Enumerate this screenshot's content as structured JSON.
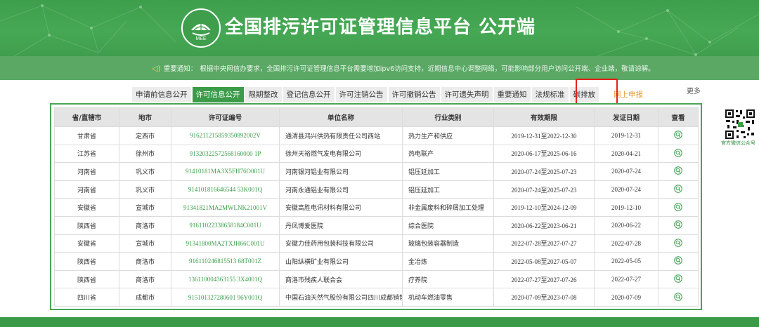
{
  "header": {
    "title": "全国排污许可证管理信息平台  公开端",
    "logo_text": "MEE"
  },
  "notice": {
    "label": "重要通知：",
    "text": "根据中央网信办要求，全国排污许可证管理信息平台需要增加ipv6访问支持，近期信息中心调整网络，可能影响部分用户访问公开端、企业端，敬请谅解。"
  },
  "tabs": [
    {
      "label": "申请前信息公开"
    },
    {
      "label": "许可信息公开"
    },
    {
      "label": "限期整改"
    },
    {
      "label": "登记信息公开"
    },
    {
      "label": "许可注销公告"
    },
    {
      "label": "许可撤销公告"
    },
    {
      "label": "许可遗失声明"
    },
    {
      "label": "重要通知"
    },
    {
      "label": "法规标准"
    },
    {
      "label": "碳排放"
    },
    {
      "label": "网上申报"
    }
  ],
  "more_label": "更多",
  "table": {
    "headers": [
      "省/直辖市",
      "地市",
      "许可证编号",
      "单位名称",
      "行业类别",
      "有效期限",
      "发证日期",
      "查看"
    ],
    "rows": [
      {
        "province": "甘肃省",
        "city": "定西市",
        "permit": "916211215859350892002V",
        "company": "通渭县鸿兴供热有限责任公司西站",
        "industry": "热力生产和供应",
        "validity": "2019-12-31至2022-12-30",
        "issue_date": "2019-12-31"
      },
      {
        "province": "江苏省",
        "city": "徐州市",
        "permit": "91320322572568160000 1P",
        "company": "徐州天裕燃气发电有限公司",
        "industry": "热电联产",
        "validity": "2020-06-17至2025-06-16",
        "issue_date": "2020-04-21"
      },
      {
        "province": "河南省",
        "city": "巩义市",
        "permit": "91410181MA3X5FH76O001U",
        "company": "河南银河铝业有限公司",
        "industry": "铝压延加工",
        "validity": "2020-07-24至2025-07-23",
        "issue_date": "2020-07-24"
      },
      {
        "province": "河南省",
        "city": "巩义市",
        "permit": "914101816646544 53K001Q",
        "company": "河南永通铝业有限公司",
        "industry": "铝压延加工",
        "validity": "2020-07-24至2025-07-23",
        "issue_date": "2020-07-24"
      },
      {
        "province": "安徽省",
        "city": "宣城市",
        "permit": "91341821MA2MWLNK21001V",
        "company": "安徽高胜电讯材料有限公司",
        "industry": "非金属废料和碎屑加工处理",
        "validity": "2019-12-10至2024-12-09",
        "issue_date": "2019-12-10"
      },
      {
        "province": "陕西省",
        "city": "商洛市",
        "permit": "91611022338658184C001U",
        "company": "丹凤博爱医院",
        "industry": "综合医院",
        "validity": "2020-06-22至2023-06-21",
        "issue_date": "2020-06-22"
      },
      {
        "province": "安徽省",
        "city": "宣城市",
        "permit": "91341800MA2TXJH66C001U",
        "company": "安徽力佳药用包装科技有限公司",
        "industry": "玻璃包装容器制造",
        "validity": "2022-07-28至2027-07-27",
        "issue_date": "2022-07-28"
      },
      {
        "province": "陕西省",
        "city": "商洛市",
        "permit": "916110246815513 68T001Z",
        "company": "山阳纵横矿业有限公司",
        "industry": "金冶炼",
        "validity": "2022-05-08至2027-05-07",
        "issue_date": "2022-05-05"
      },
      {
        "province": "陕西省",
        "city": "商洛市",
        "permit": "136110004363155 3X4001Q",
        "company": "商洛市残疾人联合会",
        "industry": "疗养院",
        "validity": "2022-07-27至2027-07-26",
        "issue_date": "2022-07-27"
      },
      {
        "province": "四川省",
        "city": "成都市",
        "permit": "915101327280601 96Y001Q",
        "company": "中国石油天然气股份有限公司四川成都销售...",
        "industry": "机动车燃油零售",
        "validity": "2020-07-09至2023-07-08",
        "issue_date": "2020-07-09"
      }
    ]
  },
  "qr": {
    "caption": "官方微信公众号"
  },
  "colors": {
    "brand_green": "#3d9e4c",
    "tab_special": "#e89a2b",
    "highlight_box": "#e2221b"
  }
}
